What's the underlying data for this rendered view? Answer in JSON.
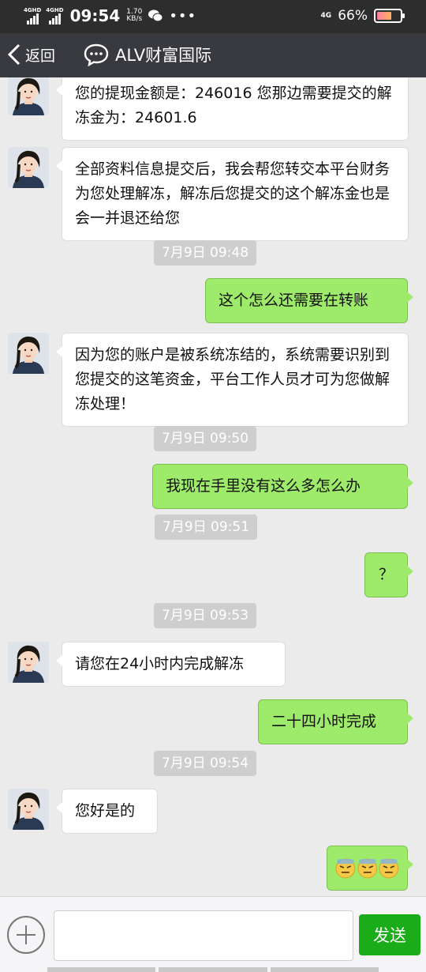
{
  "status_bar": {
    "sim1": "4GHD",
    "sim2": "4GHD",
    "time": "09:54",
    "speed_value": "1.70",
    "speed_unit": "KB/s",
    "network": "4G",
    "battery": "66%",
    "battery_level": 0.66
  },
  "header": {
    "back_label": "返回",
    "title": "ALV财富国际",
    "icons": [
      "back-chevron-icon",
      "chat-bubble-icon"
    ]
  },
  "messages": [
    {
      "type": "in",
      "text": "您的提现金额是：246016  您那边需要提交的解冻金为：24601.6"
    },
    {
      "type": "in",
      "text": "全部资料信息提交后，我会帮您转交本平台财务为您处理解冻，解冻后您提交的这个解冻金也是会一并退还给您"
    },
    {
      "type": "time",
      "text": "7月9日 09:48"
    },
    {
      "type": "out",
      "text": "这个怎么还需要在转账"
    },
    {
      "type": "in",
      "text": "因为您的账户是被系统冻结的，系统需要识别到您提交的这笔资金，平台工作人员才可为您做解冻处理！"
    },
    {
      "type": "time",
      "text": "7月9日 09:50"
    },
    {
      "type": "out",
      "text": "我现在手里没有这么多怎么办"
    },
    {
      "type": "time",
      "text": "7月9日 09:51"
    },
    {
      "type": "out",
      "text": "？"
    },
    {
      "type": "time",
      "text": "7月9日 09:53"
    },
    {
      "type": "in",
      "text": "请您在24小时内完成解冻"
    },
    {
      "type": "out",
      "text": "二十四小时完成"
    },
    {
      "type": "time",
      "text": "7月9日 09:54"
    },
    {
      "type": "in",
      "text": "您好是的"
    },
    {
      "type": "out",
      "emoji": [
        "sweat-face-emoji",
        "sweat-face-emoji",
        "sweat-face-emoji"
      ]
    }
  ],
  "input_bar": {
    "value": "",
    "send_label": "发送",
    "icons": [
      "plus-circle-icon"
    ]
  }
}
